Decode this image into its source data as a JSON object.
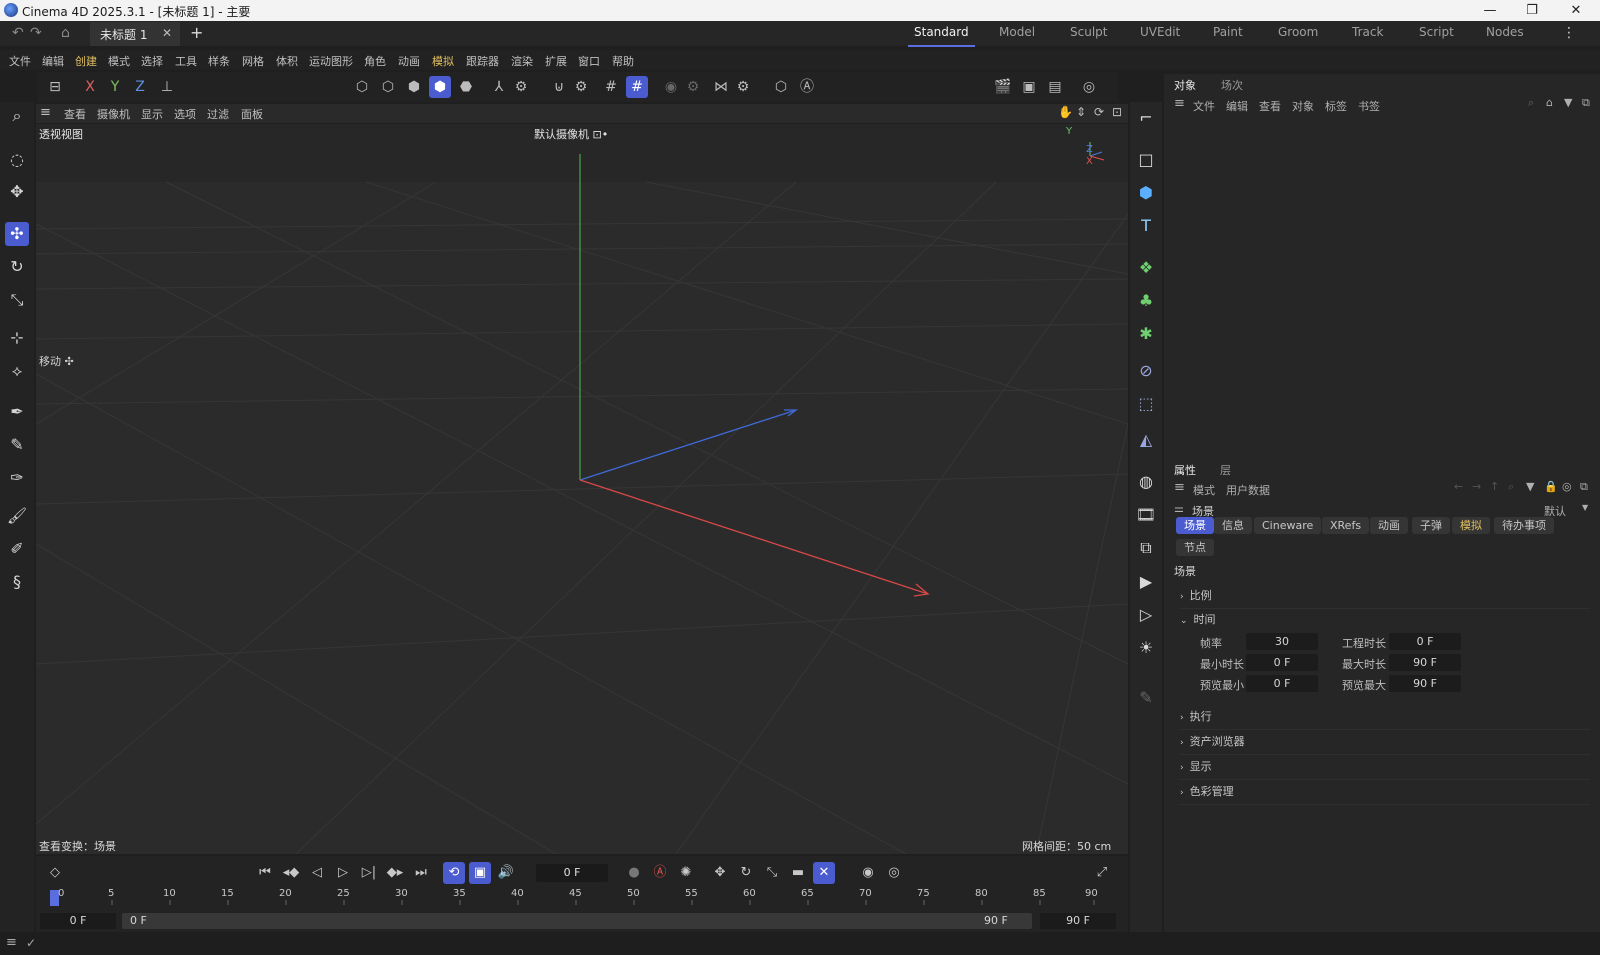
{
  "titlebar": {
    "title": "Cinema 4D 2025.3.1 - [未标题 1] - 主要",
    "minimize": "—",
    "restore": "❐",
    "close": "✕"
  },
  "tabbar": {
    "doc_tab": "未标题 1",
    "add": "+",
    "layouts": [
      "Standard",
      "Model",
      "Sculpt",
      "UVEdit",
      "Paint",
      "Groom",
      "Track",
      "Script",
      "Nodes"
    ]
  },
  "menu": [
    "文件",
    "编辑",
    "创建",
    "模式",
    "选择",
    "工具",
    "样条",
    "网格",
    "体积",
    "运动图形",
    "角色",
    "动画",
    "模拟",
    "跟踪器",
    "渲染",
    "扩展",
    "窗口",
    "帮助"
  ],
  "toolbar": {
    "x": "X",
    "y": "Y",
    "z": "Z"
  },
  "viewport_menu": [
    "查看",
    "摄像机",
    "显示",
    "选项",
    "过滤",
    "面板"
  ],
  "viewport": {
    "name": "透视视图",
    "camera": "默认摄像机 ⊡•",
    "tool_hint": "移动 ✣",
    "transform": "查看变换：场景",
    "grid_spacing": "网格间距：50 cm",
    "axis_y": "Y",
    "axis_z": "Z",
    "axis_x": "X"
  },
  "object_panel": {
    "tabs": [
      "对象",
      "场次"
    ],
    "menu": [
      "文件",
      "编辑",
      "查看",
      "对象",
      "标签",
      "书签"
    ]
  },
  "attr_panel": {
    "tabs": [
      "属性",
      "层"
    ],
    "menu": [
      "模式",
      "用户数据"
    ],
    "object_name": "场景",
    "preset": "默认",
    "chips": [
      "场景",
      "信息",
      "Cineware",
      "XRefs",
      "动画",
      "子弹",
      "模拟",
      "待办事项",
      "节点"
    ],
    "section_title": "场景",
    "groups": {
      "scale": "比例",
      "time": "时间",
      "exec": "执行",
      "asset": "资产浏览器",
      "display": "显示",
      "color": "色彩管理"
    },
    "fields": {
      "fps_label": "帧率",
      "fps": "30",
      "proj_len_label": "工程时长",
      "proj_len": "0 F",
      "min_label": "最小时长",
      "min": "0 F",
      "max_label": "最大时长",
      "max": "90 F",
      "pmin_label": "预览最小",
      "pmin": "0 F",
      "pmax_label": "预览最大",
      "pmax": "90 F"
    }
  },
  "timeline": {
    "current_frame": "0 F",
    "ticks": [
      "0",
      "5",
      "10",
      "15",
      "20",
      "25",
      "30",
      "35",
      "40",
      "45",
      "50",
      "55",
      "60",
      "65",
      "70",
      "75",
      "80",
      "85",
      "90"
    ],
    "range_start": "0 F",
    "range_inner_start": "0 F",
    "range_inner_end": "90 F",
    "range_end": "90 F"
  }
}
